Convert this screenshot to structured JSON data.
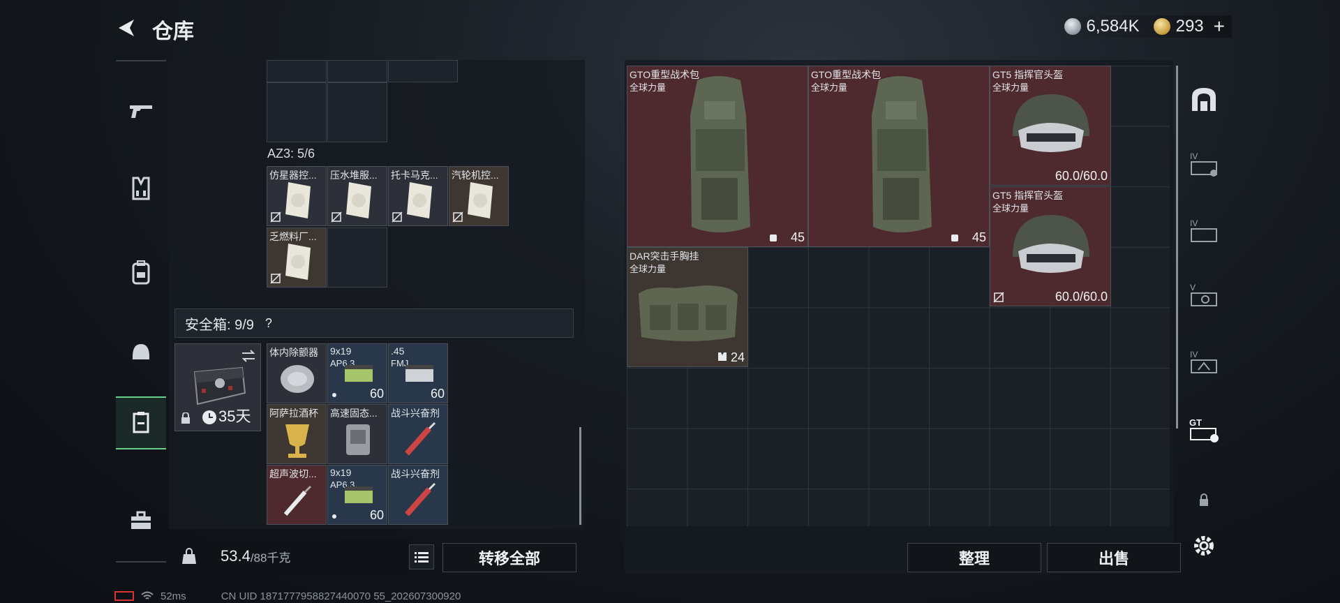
{
  "header": {
    "title": "仓库",
    "silver_value": "6,584K",
    "gold_value": "293"
  },
  "sidebar": {
    "items": [
      {
        "name": "weapons"
      },
      {
        "name": "armor-vest"
      },
      {
        "name": "backpack"
      },
      {
        "name": "helmet"
      },
      {
        "name": "storage"
      },
      {
        "name": "medkit-case"
      }
    ]
  },
  "backpack": {
    "az3_label": "AZ3: 5/6",
    "az3_items": [
      {
        "name": "仿星器控...",
        "bg": "dark"
      },
      {
        "name": "压水堆服...",
        "bg": "dark"
      },
      {
        "name": "托卡马克...",
        "bg": "dark"
      },
      {
        "name": "汽轮机控...",
        "bg": "brown"
      },
      {
        "name": "乏燃料厂...",
        "bg": "brown"
      }
    ]
  },
  "safebox": {
    "label": "安全箱: 9/9",
    "help": "?",
    "duration": "35天",
    "items": [
      {
        "name": "体内除颤器",
        "sub": "",
        "count": "",
        "bg": "dark"
      },
      {
        "name": "9x19",
        "sub": "AP6.3",
        "count": "60",
        "bg": "blue"
      },
      {
        "name": ".45",
        "sub": "FMJ",
        "count": "60",
        "bg": "blue"
      },
      {
        "name": "阿萨拉酒杯",
        "sub": "",
        "count": "",
        "bg": "brown"
      },
      {
        "name": "高速固态...",
        "sub": "",
        "count": "",
        "bg": "dark"
      },
      {
        "name": "战斗兴奋剂",
        "sub": "",
        "count": "",
        "bg": "blue"
      },
      {
        "name": "超声波切...",
        "sub": "",
        "count": "",
        "bg": "red"
      },
      {
        "name": "9x19",
        "sub": "AP6.3",
        "count": "60",
        "bg": "blue"
      },
      {
        "name": "战斗兴奋剂",
        "sub": "",
        "count": "",
        "bg": "blue"
      }
    ]
  },
  "footer_left": {
    "weight": "53.4",
    "weight_max": "/88千克",
    "transfer_all": "转移全部"
  },
  "storage": {
    "items": [
      {
        "name": "GTO重型战术包",
        "sub": "全球力量",
        "count": "45",
        "type": "backpack"
      },
      {
        "name": "GTO重型战术包",
        "sub": "全球力量",
        "count": "45",
        "type": "backpack"
      },
      {
        "name": "GT5 指挥官头盔",
        "sub": "全球力量",
        "count": "60.0/60.0",
        "type": "helmet"
      },
      {
        "name": "GT5 指挥官头盔",
        "sub": "全球力量",
        "count": "60.0/60.0",
        "type": "helmet"
      },
      {
        "name": "DAR突击手胸挂",
        "sub": "全球力量",
        "count": "24",
        "type": "vest"
      }
    ],
    "sort_button": "整理",
    "sell_button": "出售"
  },
  "right_sidebar": {
    "items": [
      "arch-icon",
      "IV",
      "IV",
      "V",
      "IV",
      "GT"
    ]
  },
  "status": {
    "ping": "52ms",
    "uid": "CN UID 1871777958827440070 55_202607300920"
  },
  "colors": {
    "accent_green": "#67d08a",
    "red_item": "#4e2a2e",
    "blue_item": "#28384a",
    "brown_item": "#3e3731"
  }
}
